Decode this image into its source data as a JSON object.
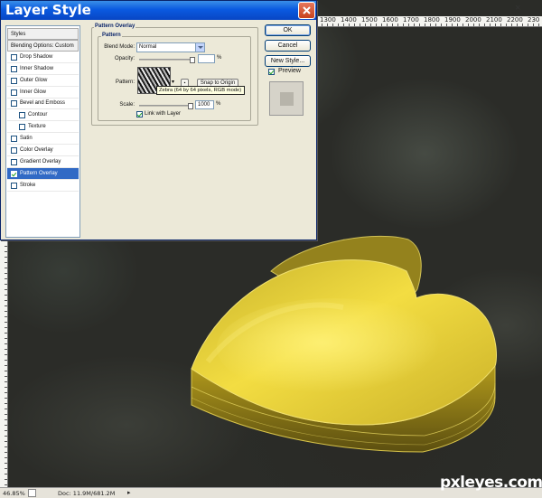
{
  "dialog": {
    "title": "Layer Style",
    "styles_list": [
      {
        "label": "Styles",
        "kind": "header",
        "checked": false
      },
      {
        "label": "Blending Options: Custom",
        "kind": "header",
        "checked": false
      },
      {
        "label": "Drop Shadow",
        "kind": "item",
        "checked": false
      },
      {
        "label": "Inner Shadow",
        "kind": "item",
        "checked": false
      },
      {
        "label": "Outer Glow",
        "kind": "item",
        "checked": false
      },
      {
        "label": "Inner Glow",
        "kind": "item",
        "checked": false
      },
      {
        "label": "Bevel and Emboss",
        "kind": "item",
        "checked": false
      },
      {
        "label": "Contour",
        "kind": "sub",
        "checked": false
      },
      {
        "label": "Texture",
        "kind": "sub",
        "checked": false
      },
      {
        "label": "Satin",
        "kind": "item",
        "checked": false
      },
      {
        "label": "Color Overlay",
        "kind": "item",
        "checked": false
      },
      {
        "label": "Gradient Overlay",
        "kind": "item",
        "checked": false
      },
      {
        "label": "Pattern Overlay",
        "kind": "item",
        "checked": true,
        "selected": true
      },
      {
        "label": "Stroke",
        "kind": "item",
        "checked": false
      }
    ],
    "section_title": "Pattern Overlay",
    "group_title": "Pattern",
    "blend_mode_label": "Blend Mode:",
    "blend_mode_value": "Normal",
    "opacity_label": "Opacity:",
    "opacity_value": "",
    "opacity_fraction": 1.0,
    "percent_sign": "%",
    "pattern_label": "Pattern:",
    "snap_button": "Snap to Origin",
    "tooltip": "Zebra (64 by 64 pixels, RGB mode)",
    "scale_label": "Scale:",
    "scale_value": "1000",
    "scale_fraction": 1.0,
    "link_label": "Link with Layer",
    "link_checked": true,
    "buttons": {
      "ok": "OK",
      "cancel": "Cancel",
      "new_style": "New Style..."
    },
    "preview_label": "Preview",
    "preview_checked": true
  },
  "ruler": {
    "top_labels": [
      "1300",
      "1400",
      "1500",
      "1600",
      "1700",
      "1800",
      "1900",
      "2000",
      "2100",
      "2200",
      "230"
    ]
  },
  "status": {
    "zoom": "46.85%",
    "doc": "Doc: 11.9M/681.2M"
  },
  "watermark": "pxleyes.com",
  "colors": {
    "titlebar": "#0a5ae0",
    "selected_row": "#316ac5",
    "heart_yellow": "#e9d23a"
  }
}
